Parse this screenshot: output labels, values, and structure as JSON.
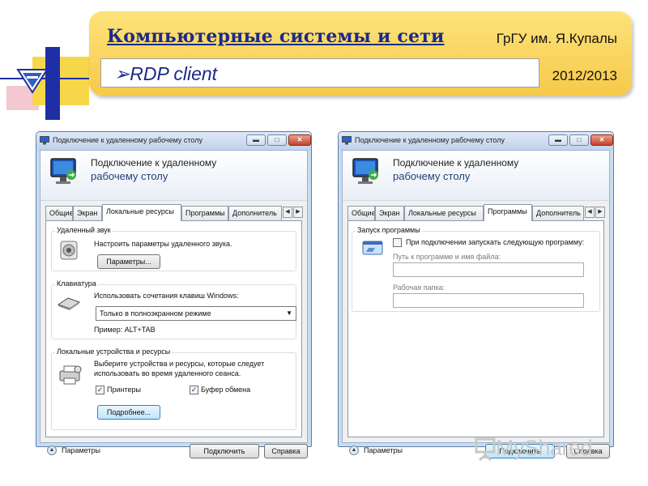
{
  "slide": {
    "title": "Компьютерные системы и сети",
    "org": "ГрГУ им. Я.Купалы",
    "subtitle": "➢RDP client",
    "year": "2012/2013"
  },
  "watermark": "MyShared",
  "colors": {
    "banner": "#f6d74a",
    "title_blue": "#1b2a8a",
    "window_border": "#5d7ea6",
    "close_red": "#c7402a"
  },
  "left_window": {
    "title": "Подключение к удаленному рабочему столу",
    "header_line1": "Подключение к удаленному",
    "header_line2": "рабочему столу",
    "tabs": [
      "Общие",
      "Экран",
      "Локальные ресурсы",
      "Программы",
      "Дополнитель"
    ],
    "active_tab": "Локальные ресурсы",
    "sound": {
      "label": "Удаленный звук",
      "text": "Настроить параметры удаленного звука.",
      "button": "Параметры..."
    },
    "keyboard": {
      "label": "Клавиатура",
      "text": "Использовать сочетания клавиш Windows:",
      "select_value": "Только в полноэкранном режиме",
      "example": "Пример: ALT+TAB"
    },
    "devices": {
      "label": "Локальные устройства и ресурсы",
      "text1": "Выберите устройства и ресурсы, которые следует",
      "text2": "использовать во время удаленного сеанса.",
      "printers_label": "Принтеры",
      "printers_checked": true,
      "clipboard_label": "Буфер обмена",
      "clipboard_checked": true,
      "more_button": "Подробнее..."
    },
    "footer": {
      "options": "Параметры",
      "connect": "Подключить",
      "help": "Справка"
    }
  },
  "right_window": {
    "title": "Подключение к удаленному рабочему столу",
    "header_line1": "Подключение к удаленному",
    "header_line2": "рабочему столу",
    "tabs": [
      "Общие",
      "Экран",
      "Локальные ресурсы",
      "Программы",
      "Дополнитель"
    ],
    "active_tab": "Программы",
    "programs": {
      "label": "Запуск программы",
      "checkbox_label": "При подключении запускать следующую программу:",
      "checked": false,
      "path_label": "Путь к программе и имя файла:",
      "path_value": "",
      "folder_label": "Рабочая папка:",
      "folder_value": ""
    },
    "footer": {
      "options": "Параметры",
      "connect": "Подключить",
      "help": "Справка"
    }
  }
}
